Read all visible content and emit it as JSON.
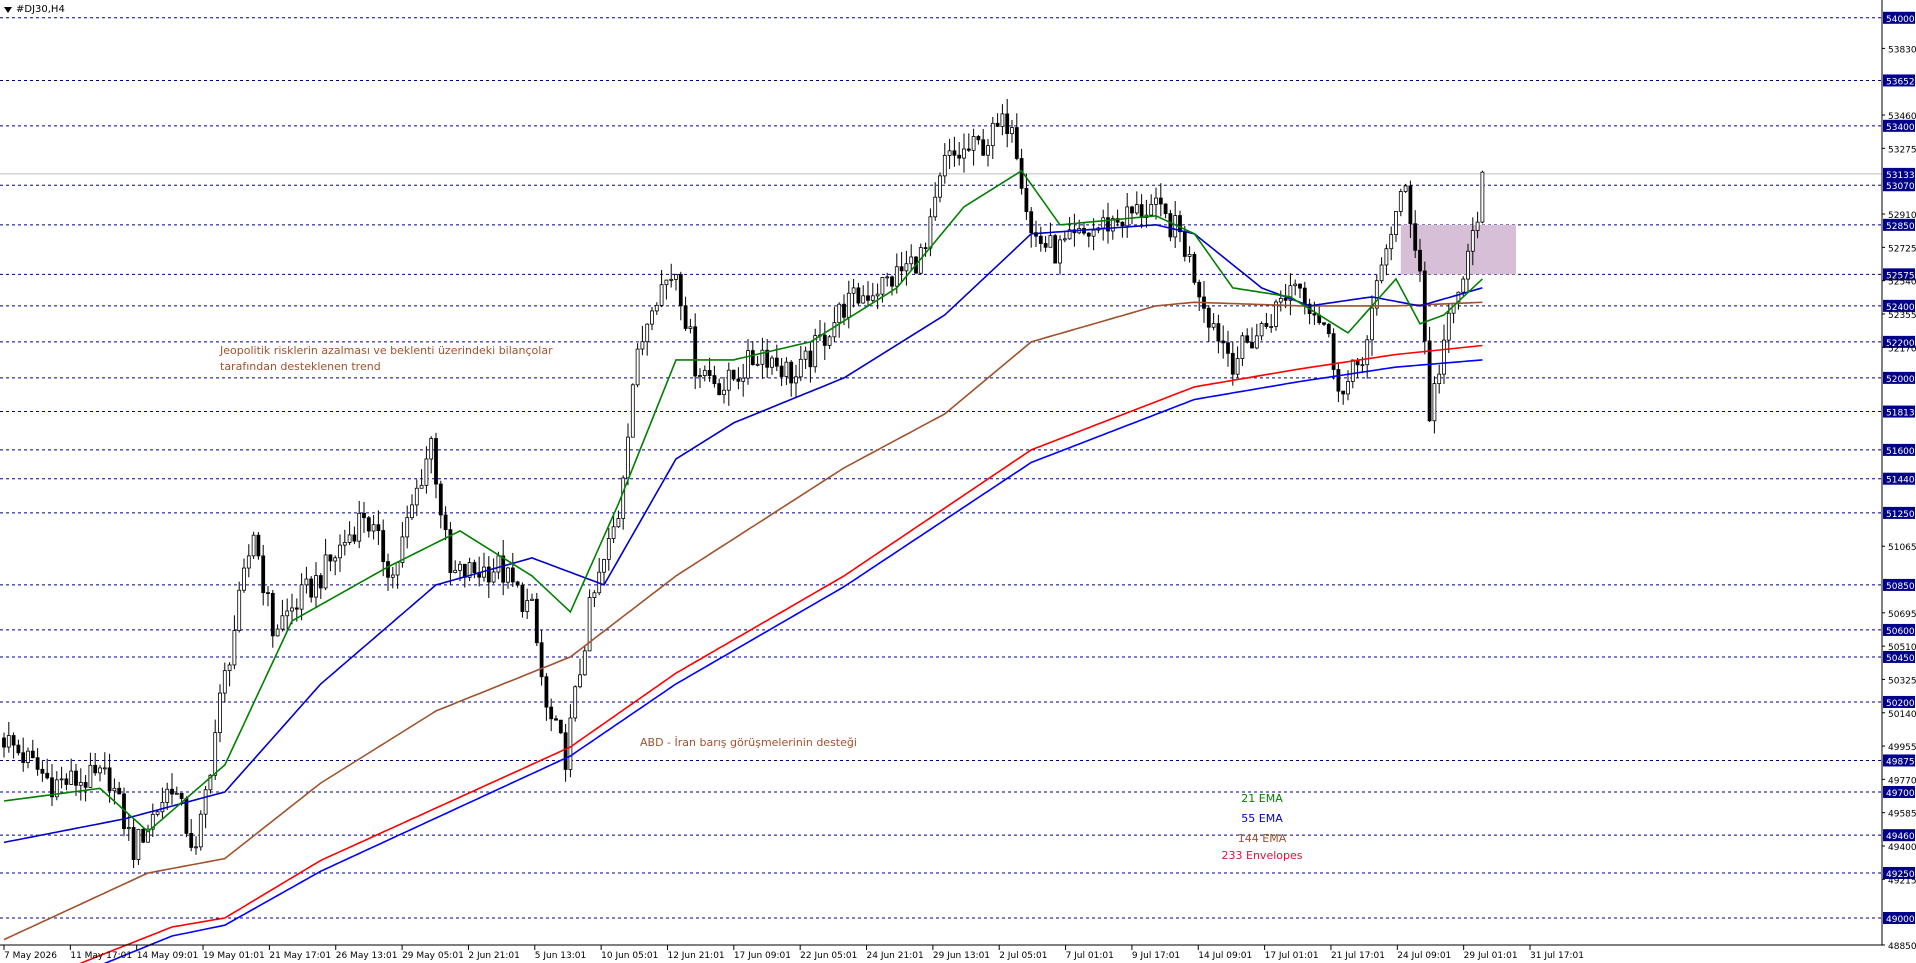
{
  "chart_data": {
    "type": "candlestick",
    "symbol": "#DJ30,H4",
    "ylim": [
      48850,
      54010
    ],
    "y_ticks": [
      54000,
      53830,
      53652,
      53460,
      53400,
      53275,
      53133,
      53070,
      52910,
      52850,
      52725,
      52575,
      52540,
      52400,
      52355,
      52200,
      52170,
      52000,
      51813,
      51600,
      51440,
      51250,
      51065,
      50850,
      50695,
      50600,
      50510,
      50450,
      50325,
      50200,
      50140,
      49955,
      49875,
      49770,
      49700,
      49585,
      49460,
      49400,
      49250,
      49215,
      49000,
      48850
    ],
    "horizontal_levels": [
      54000,
      53652,
      53400,
      53070,
      52850,
      52575,
      52400,
      52200,
      52000,
      51813,
      51600,
      51440,
      51250,
      50850,
      50600,
      50450,
      50200,
      49875,
      49700,
      49460,
      49250,
      49000
    ],
    "current_price": 53133,
    "x_ticks": [
      "7 May 2026",
      "11 May 17:01",
      "14 May 09:01",
      "19 May 01:01",
      "21 May 17:01",
      "26 May 13:01",
      "29 May 05:01",
      "2 Jun 21:01",
      "5 Jun 13:01",
      "10 Jun 05:01",
      "12 Jun 21:01",
      "17 Jun 09:01",
      "22 Jun 05:01",
      "24 Jun 21:01",
      "29 Jun 13:01",
      "2 Jul 05:01",
      "7 Jul 01:01",
      "9 Jul 17:01",
      "14 Jul 09:01",
      "17 Jul 01:01",
      "21 Jul 17:01",
      "24 Jul 09:01",
      "29 Jul 01:01",
      "31 Jul 17:01"
    ],
    "anchors": [
      [
        0,
        50000
      ],
      [
        10,
        49750
      ],
      [
        22,
        49780
      ],
      [
        27,
        49380
      ],
      [
        35,
        49750
      ],
      [
        40,
        49350
      ],
      [
        45,
        50200
      ],
      [
        52,
        51150
      ],
      [
        56,
        50600
      ],
      [
        66,
        50900
      ],
      [
        75,
        51250
      ],
      [
        81,
        50900
      ],
      [
        89,
        51650
      ],
      [
        93,
        50900
      ],
      [
        103,
        50950
      ],
      [
        110,
        50700
      ],
      [
        113,
        50150
      ],
      [
        117,
        49900
      ],
      [
        122,
        50700
      ],
      [
        128,
        51250
      ],
      [
        131,
        51980
      ],
      [
        135,
        52450
      ],
      [
        140,
        52600
      ],
      [
        144,
        52080
      ],
      [
        150,
        51950
      ],
      [
        158,
        52150
      ],
      [
        165,
        52000
      ],
      [
        175,
        52400
      ],
      [
        185,
        52550
      ],
      [
        192,
        52700
      ],
      [
        196,
        53200
      ],
      [
        204,
        53300
      ],
      [
        210,
        53450
      ],
      [
        214,
        52800
      ],
      [
        219,
        52700
      ],
      [
        229,
        52850
      ],
      [
        239,
        52950
      ],
      [
        245,
        52800
      ],
      [
        251,
        52350
      ],
      [
        256,
        52100
      ],
      [
        263,
        52300
      ],
      [
        269,
        52550
      ],
      [
        275,
        52300
      ],
      [
        279,
        51900
      ],
      [
        284,
        52200
      ],
      [
        288,
        52750
      ],
      [
        292,
        53050
      ],
      [
        295,
        52600
      ],
      [
        297,
        51800
      ],
      [
        300,
        52200
      ],
      [
        305,
        52650
      ],
      [
        308,
        53070
      ]
    ],
    "ema21_anchors": [
      [
        0,
        49650
      ],
      [
        20,
        49720
      ],
      [
        30,
        49480
      ],
      [
        46,
        49850
      ],
      [
        60,
        50650
      ],
      [
        80,
        50950
      ],
      [
        95,
        51150
      ],
      [
        110,
        50900
      ],
      [
        118,
        50700
      ],
      [
        128,
        51300
      ],
      [
        140,
        52100
      ],
      [
        152,
        52100
      ],
      [
        168,
        52200
      ],
      [
        186,
        52500
      ],
      [
        200,
        52950
      ],
      [
        212,
        53150
      ],
      [
        220,
        52850
      ],
      [
        240,
        52900
      ],
      [
        248,
        52800
      ],
      [
        256,
        52500
      ],
      [
        268,
        52450
      ],
      [
        280,
        52250
      ],
      [
        290,
        52550
      ],
      [
        295,
        52300
      ],
      [
        300,
        52350
      ],
      [
        308,
        52550
      ]
    ],
    "ema55_anchors": [
      [
        0,
        49420
      ],
      [
        25,
        49550
      ],
      [
        46,
        49700
      ],
      [
        66,
        50300
      ],
      [
        90,
        50850
      ],
      [
        110,
        51000
      ],
      [
        125,
        50850
      ],
      [
        140,
        51550
      ],
      [
        152,
        51750
      ],
      [
        175,
        52000
      ],
      [
        196,
        52350
      ],
      [
        214,
        52800
      ],
      [
        240,
        52850
      ],
      [
        248,
        52800
      ],
      [
        262,
        52500
      ],
      [
        272,
        52400
      ],
      [
        285,
        52450
      ],
      [
        295,
        52400
      ],
      [
        308,
        52500
      ]
    ],
    "ema144_anchors": [
      [
        0,
        48880
      ],
      [
        30,
        49250
      ],
      [
        46,
        49330
      ],
      [
        66,
        49750
      ],
      [
        90,
        50150
      ],
      [
        118,
        50450
      ],
      [
        140,
        50900
      ],
      [
        175,
        51500
      ],
      [
        196,
        51800
      ],
      [
        214,
        52200
      ],
      [
        240,
        52400
      ],
      [
        248,
        52420
      ],
      [
        270,
        52400
      ],
      [
        290,
        52400
      ],
      [
        308,
        52420
      ]
    ],
    "env_upper_anchors": [
      [
        0,
        48580
      ],
      [
        35,
        48950
      ],
      [
        46,
        49000
      ],
      [
        66,
        49320
      ],
      [
        118,
        49950
      ],
      [
        140,
        50360
      ],
      [
        175,
        50900
      ],
      [
        214,
        51600
      ],
      [
        248,
        51950
      ],
      [
        270,
        52050
      ],
      [
        290,
        52130
      ],
      [
        308,
        52180
      ]
    ],
    "env_lower_anchors": [
      [
        0,
        48520
      ],
      [
        35,
        48900
      ],
      [
        46,
        48960
      ],
      [
        66,
        49260
      ],
      [
        118,
        49900
      ],
      [
        140,
        50300
      ],
      [
        175,
        50840
      ],
      [
        214,
        51530
      ],
      [
        248,
        51880
      ],
      [
        270,
        51980
      ],
      [
        290,
        52060
      ],
      [
        308,
        52100
      ]
    ],
    "zone": {
      "from_bar": 291,
      "to_bar": 315,
      "low": 52575,
      "high": 52850
    },
    "legend": [
      {
        "label": "21 EMA",
        "color": "#008000"
      },
      {
        "label": "55 EMA",
        "color": "#0000cd"
      },
      {
        "label": "144 EMA",
        "color": "#a0522d"
      },
      {
        "label": "233 Envelopes",
        "color": "#dc143c"
      }
    ],
    "annotations": [
      {
        "line1": "Jeopolitik risklerin azalması ve beklenti üzerindeki bilançolar",
        "line2": "tarafından desteklenen trend",
        "color": "#a0522d"
      },
      {
        "line1": "ABD - İran barış görüşmelerinin desteği",
        "line2": "",
        "color": "#a0522d"
      }
    ]
  },
  "colors": {
    "grid": "#00008b",
    "candle": "#000000",
    "ema21": "#008000",
    "ema55": "#0000cd",
    "ema144": "#a0522d",
    "env_upper": "#ff0000",
    "env_lower": "#0000ff",
    "zone": "#d8bfd8",
    "level_label_bg": "#00008b",
    "level_label_text": "#ffffff"
  }
}
